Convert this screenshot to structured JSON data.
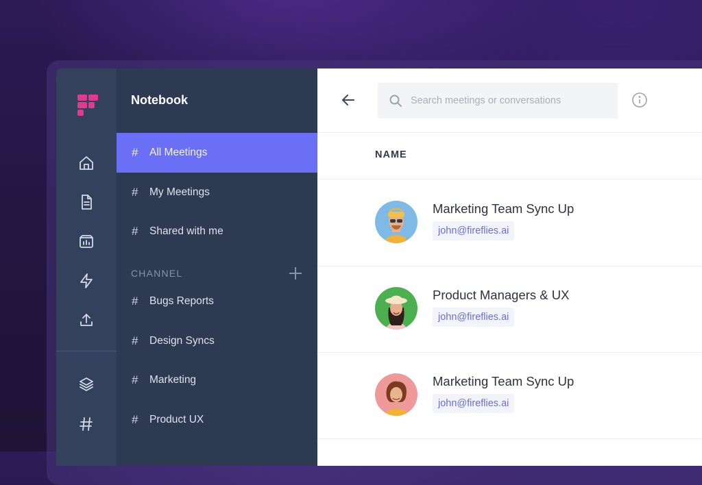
{
  "sidebar_title": "Notebook",
  "nav": {
    "all_meetings": "All Meetings",
    "my_meetings": "My Meetings",
    "shared_with_me": "Shared with me",
    "hash": "#"
  },
  "channel": {
    "header": "CHANNEL",
    "items": [
      "Bugs Reports",
      "Design Syncs",
      "Marketing",
      "Product UX"
    ]
  },
  "search": {
    "placeholder": "Search meetings or conversations"
  },
  "table": {
    "column_name": "NAME",
    "rows": [
      {
        "title": "Marketing Team Sync Up",
        "email": "john@fireflies.ai"
      },
      {
        "title": "Product Managers & UX",
        "email": "john@fireflies.ai"
      },
      {
        "title": "Marketing Team Sync Up",
        "email": "john@fireflies.ai"
      }
    ]
  },
  "colors": {
    "active_nav": "#6b6ff5",
    "brand_logo": "#e03a8c",
    "rail_bg": "#33415c",
    "panel_bg": "#2d3a52",
    "email_text": "#6b6fd6"
  },
  "icons": {
    "logo": "fireflies-logo",
    "rail": [
      "home-icon",
      "document-icon",
      "meeting-board-icon",
      "lightning-icon",
      "upload-icon",
      "layers-icon",
      "hash-icon"
    ],
    "back": "arrow-left-icon",
    "search": "search-icon",
    "info": "info-icon"
  }
}
